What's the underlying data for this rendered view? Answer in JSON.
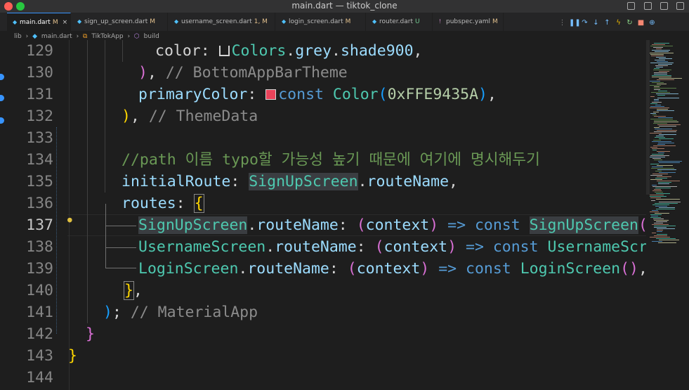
{
  "window": {
    "title": "main.dart — tiktok_clone"
  },
  "tabs": [
    {
      "name": "main.dart",
      "status": "M",
      "type": "dart",
      "active": true
    },
    {
      "name": "sign_up_screen.dart",
      "status": "M",
      "type": "dart",
      "active": false
    },
    {
      "name": "username_screen.dart",
      "status": "1, M",
      "type": "dart",
      "active": false
    },
    {
      "name": "login_screen.dart",
      "status": "M",
      "type": "dart",
      "active": false
    },
    {
      "name": "router.dart",
      "status": "U",
      "type": "dart",
      "active": false
    },
    {
      "name": "pubspec.yaml",
      "status": "M",
      "type": "yaml",
      "active": false
    }
  ],
  "breadcrumb": [
    "lib",
    "main.dart",
    "TikTokApp",
    "build"
  ],
  "editor": {
    "current_line": 137,
    "lines": [
      {
        "num": 129,
        "parts": [
          [
            "",
            "color: "
          ],
          [
            "sw-grey",
            ""
          ],
          [
            "t",
            "Colors"
          ],
          [
            "",
            "."
          ],
          [
            "p",
            "grey"
          ],
          [
            "",
            "."
          ],
          [
            "p",
            "shade900"
          ],
          [
            "",
            ","
          ]
        ]
      },
      {
        "num": 130,
        "parts": [
          [
            "bp",
            ")"
          ],
          [
            "",
            ", "
          ],
          [
            "cg",
            "// BottomAppBarTheme"
          ]
        ]
      },
      {
        "num": 131,
        "parts": [
          [
            "p",
            "primaryColor"
          ],
          [
            "",
            ": "
          ],
          [
            "sw-pink",
            ""
          ],
          [
            "k",
            "const "
          ],
          [
            "t",
            "Color"
          ],
          [
            "bb",
            "("
          ],
          [
            "n",
            "0xFFE9435A"
          ],
          [
            "bb",
            ")"
          ],
          [
            "",
            ","
          ]
        ]
      },
      {
        "num": 132,
        "parts": [
          [
            "by",
            ")"
          ],
          [
            "",
            ", "
          ],
          [
            "cg",
            "// ThemeData"
          ]
        ]
      },
      {
        "num": 133,
        "parts": []
      },
      {
        "num": 134,
        "parts": [
          [
            "cm",
            "//path 이름 typo할 가능성 높기 때문에 여기에 명시해두기"
          ]
        ]
      },
      {
        "num": 135,
        "parts": [
          [
            "p",
            "initialRoute"
          ],
          [
            "",
            ": "
          ],
          [
            "t-hl",
            "SignUpScreen"
          ],
          [
            "",
            "."
          ],
          [
            "p",
            "routeName"
          ],
          [
            "",
            ","
          ]
        ]
      },
      {
        "num": 136,
        "parts": [
          [
            "p",
            "routes"
          ],
          [
            "",
            ": "
          ],
          [
            "by-box",
            "{"
          ]
        ]
      },
      {
        "num": 137,
        "parts": [
          [
            "t-hl",
            "SignUpScreen"
          ],
          [
            "",
            "."
          ],
          [
            "p",
            "routeName"
          ],
          [
            "",
            ": "
          ],
          [
            "bp",
            "("
          ],
          [
            "p",
            "context"
          ],
          [
            "bp",
            ")"
          ],
          [
            "k",
            " => const "
          ],
          [
            "t-hl",
            "SignUpScreen"
          ],
          [
            "bp",
            "()"
          ],
          [
            "",
            ","
          ]
        ]
      },
      {
        "num": 138,
        "parts": [
          [
            "t",
            "UsernameScreen"
          ],
          [
            "",
            "."
          ],
          [
            "p",
            "routeName"
          ],
          [
            "",
            ": "
          ],
          [
            "bp",
            "("
          ],
          [
            "p",
            "context"
          ],
          [
            "bp",
            ")"
          ],
          [
            "k",
            " => const "
          ],
          [
            "t",
            "UsernameScreen"
          ],
          [
            "bp",
            "()"
          ],
          [
            "",
            ","
          ]
        ]
      },
      {
        "num": 139,
        "parts": [
          [
            "t",
            "LoginScreen"
          ],
          [
            "",
            "."
          ],
          [
            "p",
            "routeName"
          ],
          [
            "",
            ": "
          ],
          [
            "bp",
            "("
          ],
          [
            "p",
            "context"
          ],
          [
            "bp",
            ")"
          ],
          [
            "k",
            " => const "
          ],
          [
            "t",
            "LoginScreen"
          ],
          [
            "bp",
            "()"
          ],
          [
            "",
            ","
          ]
        ]
      },
      {
        "num": 140,
        "parts": [
          [
            "by-box",
            "}"
          ],
          [
            "",
            ","
          ]
        ]
      },
      {
        "num": 141,
        "parts": [
          [
            "bb",
            ")"
          ],
          [
            "",
            "; "
          ],
          [
            "cg",
            "// MaterialApp"
          ]
        ]
      },
      {
        "num": 142,
        "parts": [
          [
            "bp",
            "}"
          ]
        ]
      },
      {
        "num": 143,
        "parts": [
          [
            "by",
            "}"
          ]
        ]
      },
      {
        "num": 144,
        "parts": []
      }
    ]
  },
  "colors": {
    "accent": "#3794ff",
    "modified": "#e2c08d",
    "untracked": "#73c991",
    "swatch_primary": "#e9435a"
  }
}
